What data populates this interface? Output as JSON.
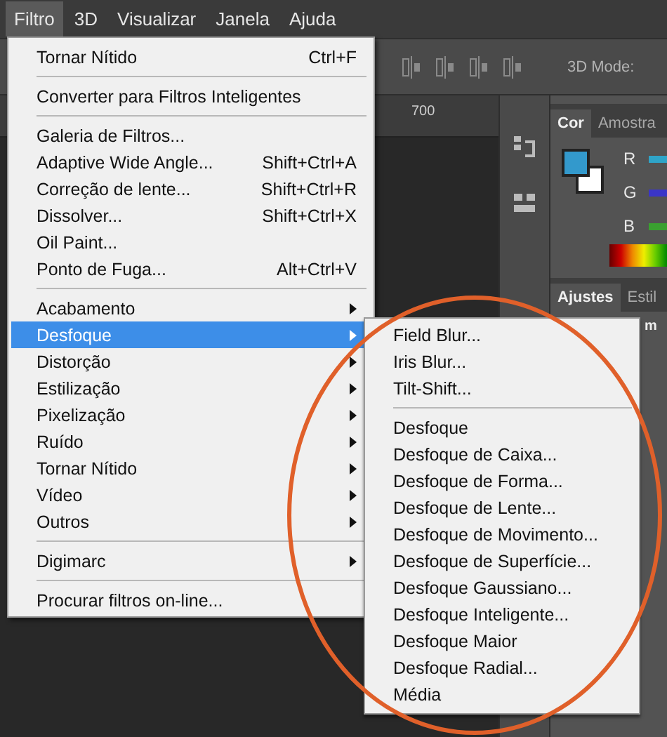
{
  "menu_bar": [
    {
      "label": "Filtro",
      "selected": true
    },
    {
      "label": "3D",
      "selected": false
    },
    {
      "label": "Visualizar",
      "selected": false
    },
    {
      "label": "Janela",
      "selected": false
    },
    {
      "label": "Ajuda",
      "selected": false
    }
  ],
  "options_bar": {
    "label": "3D Mode:"
  },
  "ruler": {
    "tick_label": "700"
  },
  "color_panel": {
    "tabs": [
      {
        "label": "Cor",
        "selected": true
      },
      {
        "label": "Amostra",
        "selected": false
      }
    ],
    "sliders": [
      {
        "label": "R",
        "color": "#2fa4c8"
      },
      {
        "label": "G",
        "color": "#3a35c8"
      },
      {
        "label": "B",
        "color": "#3aa030"
      }
    ]
  },
  "adjustments_panel": {
    "tabs": [
      {
        "label": "Ajustes",
        "selected": true
      },
      {
        "label": "Estil",
        "selected": false
      }
    ],
    "heading": "m"
  },
  "filter_menu": [
    {
      "kind": "item",
      "label": "Tornar Nítido",
      "shortcut": "Ctrl+F"
    },
    {
      "kind": "separator"
    },
    {
      "kind": "item",
      "label": "Converter para Filtros Inteligentes"
    },
    {
      "kind": "separator"
    },
    {
      "kind": "item",
      "label": "Galeria de Filtros..."
    },
    {
      "kind": "item",
      "label": "Adaptive Wide Angle...",
      "shortcut": "Shift+Ctrl+A"
    },
    {
      "kind": "item",
      "label": "Correção de lente...",
      "shortcut": "Shift+Ctrl+R"
    },
    {
      "kind": "item",
      "label": "Dissolver...",
      "shortcut": "Shift+Ctrl+X"
    },
    {
      "kind": "item",
      "label": "Oil Paint..."
    },
    {
      "kind": "item",
      "label": "Ponto de Fuga...",
      "shortcut": "Alt+Ctrl+V"
    },
    {
      "kind": "separator"
    },
    {
      "kind": "submenu",
      "label": "Acabamento",
      "selected": false
    },
    {
      "kind": "submenu",
      "label": "Desfoque",
      "selected": true
    },
    {
      "kind": "submenu",
      "label": "Distorção",
      "selected": false
    },
    {
      "kind": "submenu",
      "label": "Estilização",
      "selected": false
    },
    {
      "kind": "submenu",
      "label": "Pixelização",
      "selected": false
    },
    {
      "kind": "submenu",
      "label": "Ruído",
      "selected": false
    },
    {
      "kind": "submenu",
      "label": "Tornar Nítido",
      "selected": false
    },
    {
      "kind": "submenu",
      "label": "Vídeo",
      "selected": false
    },
    {
      "kind": "submenu",
      "label": "Outros",
      "selected": false
    },
    {
      "kind": "separator"
    },
    {
      "kind": "submenu",
      "label": "Digimarc",
      "selected": false
    },
    {
      "kind": "separator"
    },
    {
      "kind": "item",
      "label": "Procurar filtros on-line..."
    }
  ],
  "blur_submenu": [
    {
      "kind": "item",
      "label": "Field Blur..."
    },
    {
      "kind": "item",
      "label": "Iris Blur..."
    },
    {
      "kind": "item",
      "label": "Tilt-Shift..."
    },
    {
      "kind": "separator"
    },
    {
      "kind": "item",
      "label": "Desfoque"
    },
    {
      "kind": "item",
      "label": "Desfoque de Caixa..."
    },
    {
      "kind": "item",
      "label": "Desfoque de Forma..."
    },
    {
      "kind": "item",
      "label": "Desfoque de Lente..."
    },
    {
      "kind": "item",
      "label": "Desfoque de Movimento..."
    },
    {
      "kind": "item",
      "label": "Desfoque de Superfície..."
    },
    {
      "kind": "item",
      "label": "Desfoque Gaussiano..."
    },
    {
      "kind": "item",
      "label": "Desfoque Inteligente..."
    },
    {
      "kind": "item",
      "label": "Desfoque Maior"
    },
    {
      "kind": "item",
      "label": "Desfoque Radial..."
    },
    {
      "kind": "item",
      "label": "Média"
    }
  ],
  "annotation": {
    "color": "#e0602a"
  }
}
